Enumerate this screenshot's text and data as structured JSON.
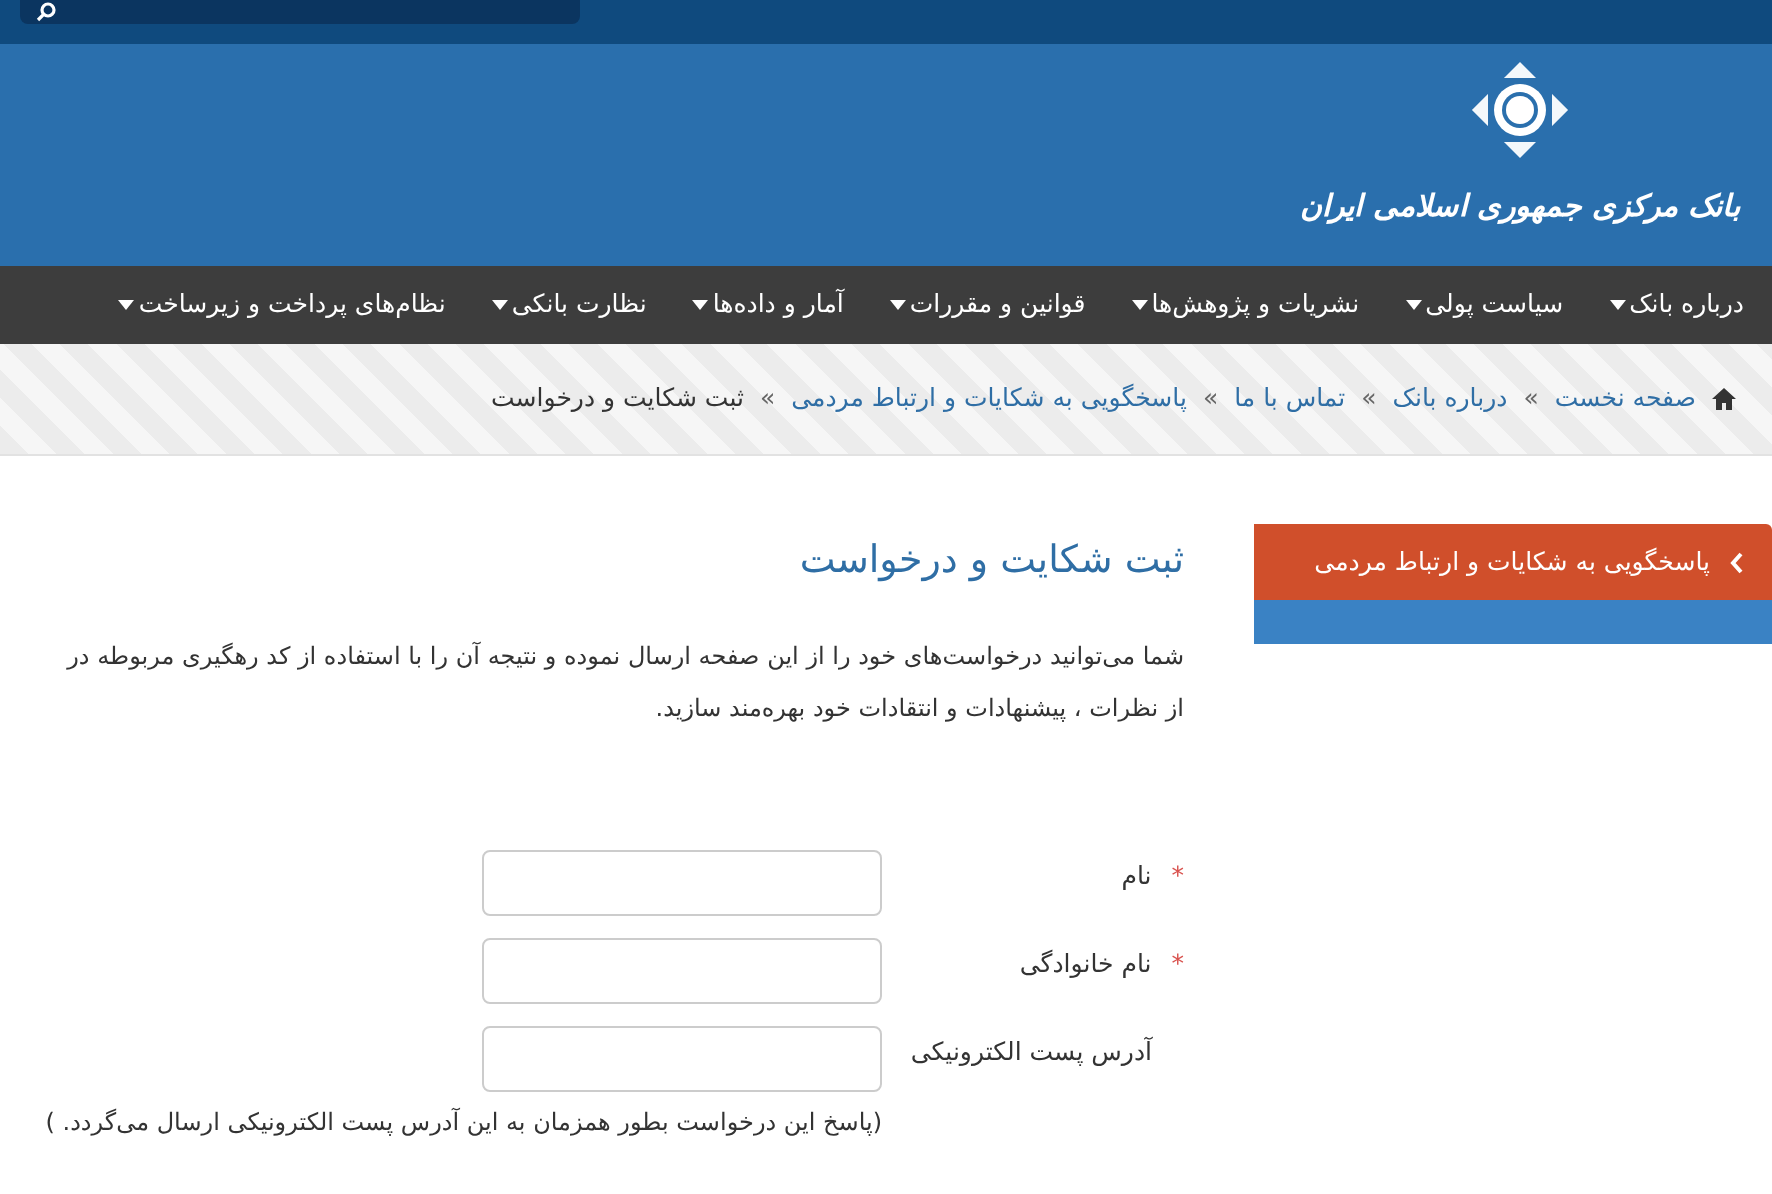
{
  "header": {
    "logo_text": "بانک مرکزی جمهوری اسلامی ایران"
  },
  "nav": {
    "items": [
      {
        "label": "درباره بانک"
      },
      {
        "label": "سیاست پولی"
      },
      {
        "label": "نشریات و پژوهش‌ها"
      },
      {
        "label": "قوانین و مقررات"
      },
      {
        "label": "آمار و داده‌ها"
      },
      {
        "label": "نظارت بانکی"
      },
      {
        "label": "نظام‌های پرداخت و زیرساخت"
      }
    ]
  },
  "breadcrumb": {
    "items": [
      {
        "label": "صفحه نخست",
        "kind": "link"
      },
      {
        "label": "درباره بانک",
        "kind": "link"
      },
      {
        "label": "تماس با ما",
        "kind": "link"
      },
      {
        "label": "پاسخگویی به شکایات و ارتباط مردمی",
        "kind": "link"
      },
      {
        "label": "ثبت شکایت و درخواست",
        "kind": "current"
      }
    ],
    "separator": "»"
  },
  "sidebar": {
    "title": "پاسخگویی به شکایات و ارتباط مردمی"
  },
  "content": {
    "title": "ثبت شکایت و درخواست",
    "intro": [
      "شما می‌توانید درخواست‌های خود را از این صفحه ارسال نموده و نتیجه آن را با استفاده از کد رهگیری مربوطه در",
      "از نظرات ، پیشنهادات و انتقادات خود بهره‌مند سازید."
    ],
    "required_mark": "*",
    "fields": [
      {
        "label": "نام",
        "required": true
      },
      {
        "label": "نام خانوادگی",
        "required": true
      },
      {
        "label": "آدرس پست الکترونیکی",
        "required": false
      }
    ],
    "note": "(پاسخ این درخواست بطور همزمان به  این آدرس پست الکترونیکی ارسال می‌گردد. )"
  }
}
